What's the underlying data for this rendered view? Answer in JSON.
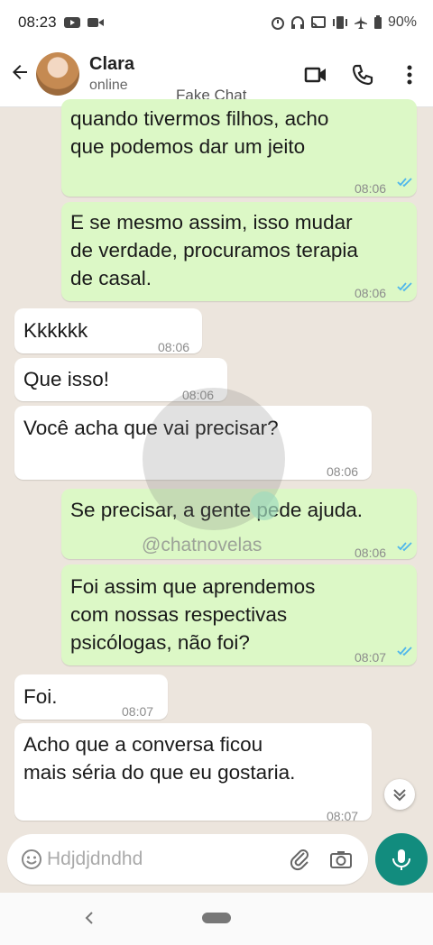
{
  "status_bar": {
    "time": "08:23",
    "battery": "90%"
  },
  "header": {
    "contact_name": "Clara",
    "contact_status": "online",
    "overlay_label": "Fake Chat"
  },
  "messages": [
    {
      "dir": "out",
      "text": "quando tivermos filhos, acho\nque podemos dar um jeito",
      "time": "08:06"
    },
    {
      "dir": "out",
      "text": "E se mesmo assim, isso mudar\nde verdade, procuramos terapia\nde casal.",
      "time": "08:06"
    },
    {
      "dir": "in",
      "text": "Kkkkkk",
      "time": "08:06"
    },
    {
      "dir": "in",
      "text": "Que isso!",
      "time": "08:06"
    },
    {
      "dir": "in",
      "text": "Você acha que vai precisar?",
      "time": "08:06"
    },
    {
      "dir": "out",
      "text": "Se precisar, a gente pede ajuda.",
      "time": "08:06"
    },
    {
      "dir": "out",
      "text": "Foi assim que aprendemos\ncom nossas respectivas\npsicólogas, não foi?",
      "time": "08:07"
    },
    {
      "dir": "in",
      "text": "Foi.",
      "time": "08:07"
    },
    {
      "dir": "in",
      "text": "Acho que a conversa ficou\nmais séria do que eu gostaria.",
      "time": "08:07"
    }
  ],
  "watermark": "@chatnovelas",
  "input": {
    "text": "Hdjdjdndhd"
  },
  "colors": {
    "outgoing": "#dcf8c6",
    "incoming": "#ffffff",
    "accent": "#128c7e",
    "background": "#ece5dd",
    "read_ticks": "#4fb6ec"
  },
  "icons": [
    "back-arrow-icon",
    "video-call-icon",
    "phone-icon",
    "more-vert-icon",
    "emoji-icon",
    "attach-icon",
    "camera-icon",
    "mic-icon",
    "scroll-down-icon"
  ]
}
